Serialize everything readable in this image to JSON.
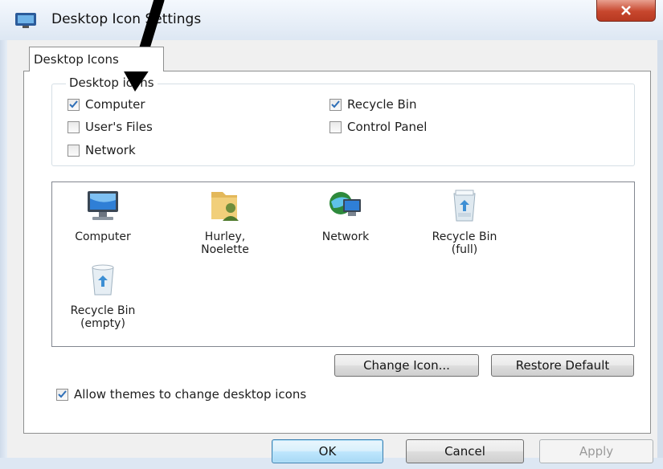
{
  "window": {
    "title": "Desktop Icon Settings",
    "close_label": "x"
  },
  "tabs": [
    {
      "label": "Desktop Icons"
    }
  ],
  "group": {
    "title": "Desktop icons",
    "items": [
      {
        "label": "Computer",
        "checked": true
      },
      {
        "label": "User's Files",
        "checked": false
      },
      {
        "label": "Network",
        "checked": false
      },
      {
        "label": "Recycle Bin",
        "checked": true
      },
      {
        "label": "Control Panel",
        "checked": false
      }
    ]
  },
  "icons": [
    {
      "label": "Computer",
      "icon": "computer-icon"
    },
    {
      "label": "Hurley,\nNoelette",
      "icon": "user-folder-icon"
    },
    {
      "label": "Network",
      "icon": "network-icon"
    },
    {
      "label": "Recycle Bin\n(full)",
      "icon": "recycle-bin-full-icon"
    },
    {
      "label": "Recycle Bin\n(empty)",
      "icon": "recycle-bin-empty-icon"
    }
  ],
  "buttons": {
    "change_icon": "Change Icon...",
    "restore_default": "Restore Default",
    "ok": "OK",
    "cancel": "Cancel",
    "apply": "Apply"
  },
  "allow_themes": {
    "label": "Allow themes to change desktop icons",
    "checked": true
  },
  "colors": {
    "close": "#c7462d",
    "check": "#2f6fb7",
    "arrow": "#000000"
  }
}
